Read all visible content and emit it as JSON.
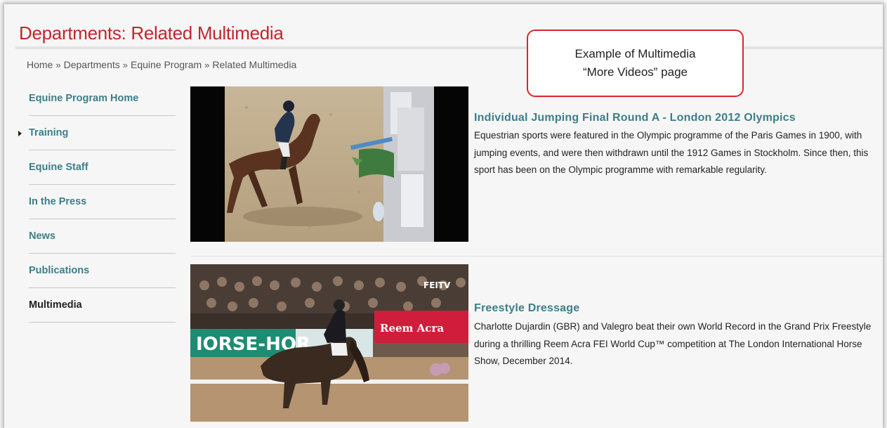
{
  "page": {
    "title": "Departments: Related Multimedia",
    "breadcrumb": [
      "Home",
      "Departments",
      "Equine Program",
      "Related Multimedia"
    ],
    "breadcrumb_separator": "»"
  },
  "callout": {
    "line1": "Example of Multimedia",
    "line2": "“More Videos” page"
  },
  "sidebar": {
    "items": [
      {
        "label": "Equine Program Home"
      },
      {
        "label": "Training"
      },
      {
        "label": "Equine Staff"
      },
      {
        "label": "In the Press"
      },
      {
        "label": "News"
      },
      {
        "label": "Publications"
      },
      {
        "label": "Multimedia"
      }
    ]
  },
  "videos": [
    {
      "title": "Individual Jumping Final Round A - London 2012 Olympics",
      "description": "Equestrian sports were featured in the Olympic programme of the Paris Games in 1900, with jumping events, and were then withdrawn until the 1912 Games in Stockholm. Since then, this sport has been on the Olympic programme with remarkable regularity."
    },
    {
      "title": "Freestyle Dressage",
      "description": "Charlotte Dujardin (GBR) and Valegro beat their own World Record in the Grand Prix Freestyle during a thrilling Reem Acra FEI World Cup™ competition at The London International Horse Show, December 2014.",
      "thumb_texts": {
        "watermark": "FEITV",
        "banner_left": "IORSE-HOR",
        "banner_right": "Reem Acra"
      }
    }
  ],
  "colors": {
    "title_red": "#c0272d",
    "link_teal": "#3d7e88",
    "callout_border": "#d9262c"
  }
}
